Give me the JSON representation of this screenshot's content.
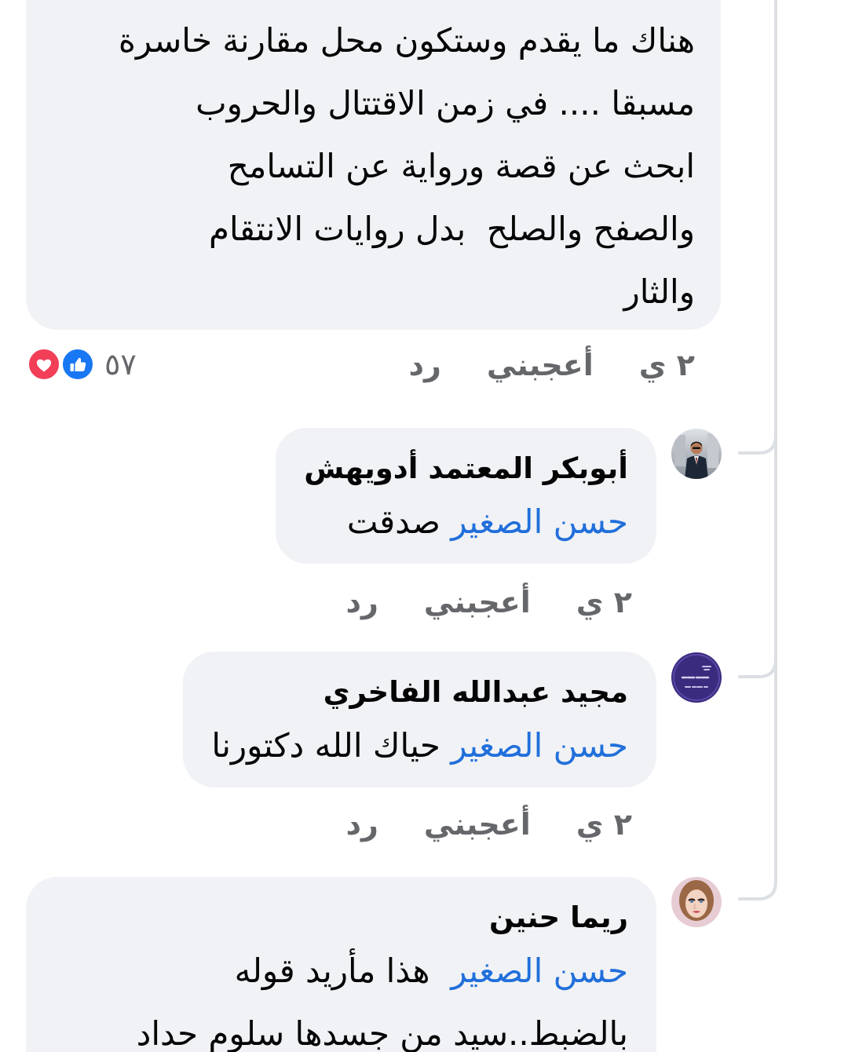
{
  "main_comment": {
    "body_lines": [
      "هناك ما يقدم وستكون محل مقارنة خاسرة",
      "مسبقا .... في زمن الاقتتال والحروب",
      "ابحث عن قصة ورواية عن التسامح",
      "والصفح والصلح  بدل روايات الانتقام",
      "والثار"
    ],
    "time": "٢ ي",
    "like_label": "أعجبني",
    "reply_label": "رد",
    "reactions": {
      "icons": [
        "heart-icon",
        "like-icon"
      ],
      "count": "٥٧"
    }
  },
  "replies": [
    {
      "author": "أبوبكر المعتمد أدويهش",
      "mention": "حسن الصغير",
      "body_lines": [
        "صدقت"
      ],
      "time": "٢ ي",
      "like_label": "أعجبني",
      "reply_label": "رد"
    },
    {
      "author": "مجيد عبدالله الفاخري",
      "mention": "حسن الصغير",
      "body_lines": [
        "حياك الله دكتورنا"
      ],
      "time": "٢ ي",
      "like_label": "أعجبني",
      "reply_label": "رد"
    },
    {
      "author": "ريما حنين",
      "mention": "حسن الصغير",
      "body_lines": [
        "هذا مأريد قوله",
        "بالضبط..سيد من جسدها سلوم حداد"
      ]
    }
  ],
  "colors": {
    "bubble": "#f0f2f5",
    "text": "#050505",
    "mention": "#216fdb",
    "meta": "#65676b",
    "thread": "#dcdfe3",
    "heart": "#f33e58",
    "like": "#1877f2"
  }
}
